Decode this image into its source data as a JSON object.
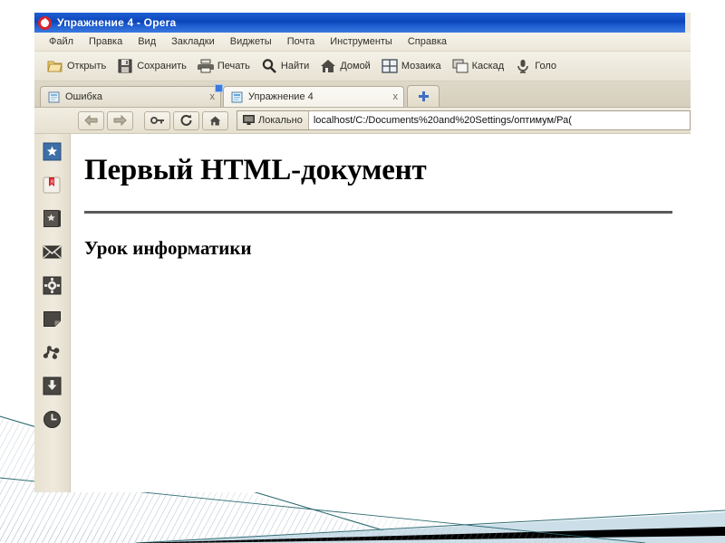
{
  "window": {
    "title": "Упражнение 4 - Opera",
    "logo_icon": "opera-logo-icon"
  },
  "menubar": {
    "items": [
      {
        "label": "Файл"
      },
      {
        "label": "Правка"
      },
      {
        "label": "Вид"
      },
      {
        "label": "Закладки"
      },
      {
        "label": "Виджеты"
      },
      {
        "label": "Почта"
      },
      {
        "label": "Инструменты"
      },
      {
        "label": "Справка"
      }
    ]
  },
  "toolbar": {
    "buttons": [
      {
        "label": "Открыть",
        "icon": "folder-icon"
      },
      {
        "label": "Сохранить",
        "icon": "floppy-disk-icon"
      },
      {
        "label": "Печать",
        "icon": "printer-icon"
      },
      {
        "label": "Найти",
        "icon": "search-icon"
      },
      {
        "label": "Домой",
        "icon": "home-icon"
      },
      {
        "label": "Мозаика",
        "icon": "tile-windows-icon"
      },
      {
        "label": "Каскад",
        "icon": "cascade-windows-icon"
      },
      {
        "label": "Голо",
        "icon": "microphone-icon"
      }
    ]
  },
  "tabs": {
    "items": [
      {
        "label": "Ошибка",
        "close": "x",
        "active": false,
        "icon": "page-icon"
      },
      {
        "label": "Упражнение 4",
        "close": "x",
        "active": true,
        "icon": "page-icon"
      }
    ],
    "new_tab_label": "+"
  },
  "navigation": {
    "buttons": [
      {
        "icon": "back-arrow-icon"
      },
      {
        "icon": "forward-arrow-icon"
      },
      {
        "icon": "key-icon"
      },
      {
        "icon": "reload-icon"
      },
      {
        "icon": "home-icon"
      }
    ],
    "security_badge": {
      "label": "Локально",
      "icon": "monitor-icon"
    },
    "url": "localhost/C:/Documents%20and%20Settings/оптимум/Ра("
  },
  "sidebar": {
    "items": [
      {
        "icon": "panel-star-blue-icon",
        "name": "panels"
      },
      {
        "icon": "opera-link-icon",
        "name": "opera-link"
      },
      {
        "icon": "bookmarks-book-icon",
        "name": "bookmarks"
      },
      {
        "icon": "mail-envelope-icon",
        "name": "mail"
      },
      {
        "icon": "gear-icon",
        "name": "widgets"
      },
      {
        "icon": "notes-icon",
        "name": "notes"
      },
      {
        "icon": "links-icon",
        "name": "links"
      },
      {
        "icon": "download-arrow-icon",
        "name": "transfers"
      },
      {
        "icon": "clock-icon",
        "name": "history"
      }
    ]
  },
  "page_content": {
    "heading": "Первый HTML-документ",
    "paragraph": "Урок информатики",
    "divider": "hr"
  },
  "colors": {
    "titlebar_blue": "#0b46b8",
    "opera_red": "#d8232a",
    "chrome_beige": "#ece7da",
    "deco_black": "#000000",
    "deco_blue": "#ccdfe9",
    "deco_teal": "#2e6b72"
  }
}
